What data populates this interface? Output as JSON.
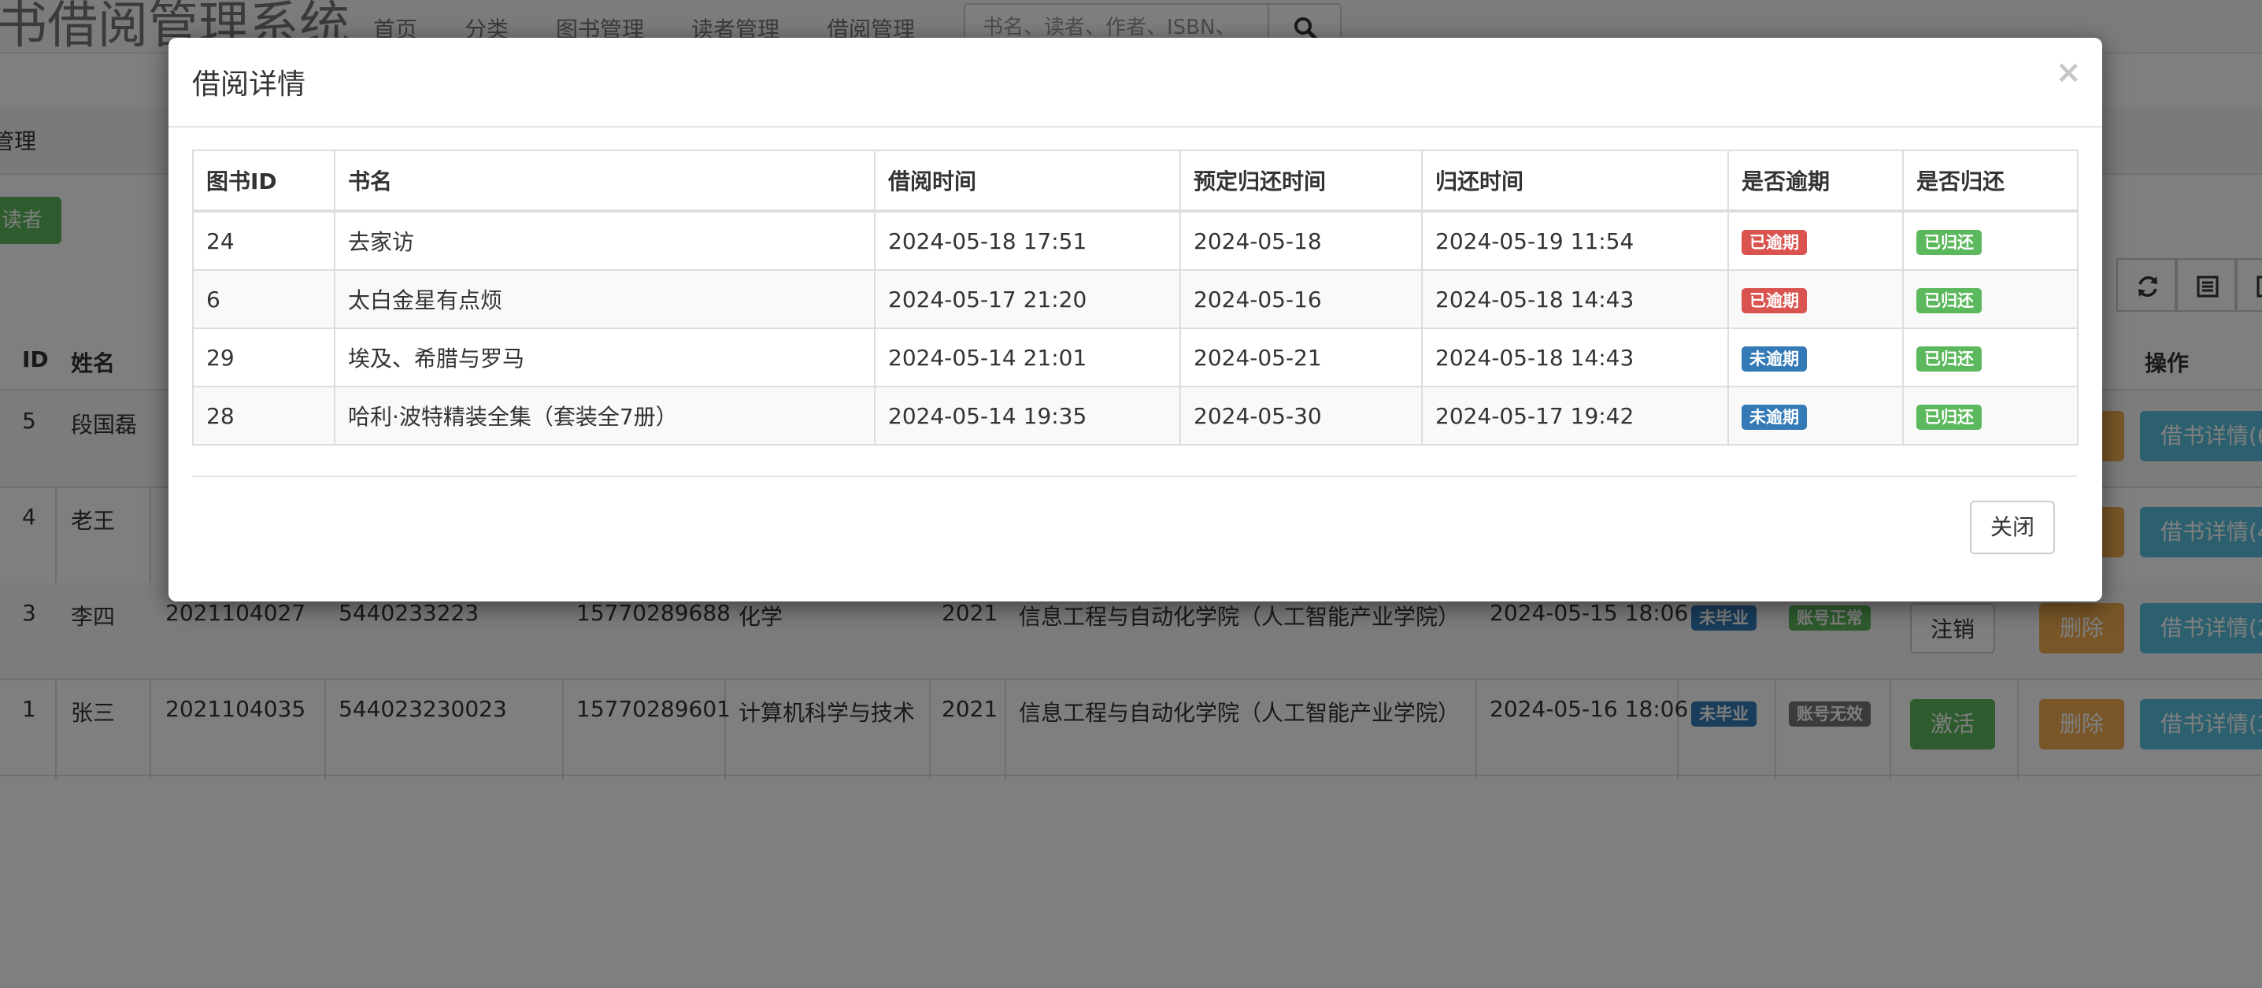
{
  "app": {
    "brand": "书借阅管理系统",
    "nav": [
      "首页",
      "分类",
      "图书管理",
      "读者管理",
      "借阅管理"
    ],
    "search_placeholder": "书名、读者、作者、ISBN、"
  },
  "breadcrumb": "管理",
  "add_reader_label": "读者",
  "reader_table": {
    "headers": [
      "ID",
      "姓名",
      "操作"
    ],
    "rows": [
      {
        "id": "5",
        "name": "段国磊",
        "detail_label": "借书详情(6"
      },
      {
        "id": "4",
        "name": "老王",
        "detail_label": "借书详情(4"
      },
      {
        "id": "3",
        "name": "李四",
        "student_no": "2021104027",
        "card_no": "5440233223",
        "phone": "15770289688",
        "major": "化学",
        "year": "2021",
        "college": "信息工程与自动化学院（人工智能产业学院）",
        "time": "2024-05-15 18:06",
        "grad_status": "未毕业",
        "account_status": "账号正常",
        "action_label": "注销",
        "delete_label": "删除",
        "detail_label": "借书详情(2"
      },
      {
        "id": "1",
        "name": "张三",
        "student_no": "2021104035",
        "card_no": "544023230023",
        "phone": "15770289601",
        "major": "计算机科学与技术",
        "year": "2021",
        "college": "信息工程与自动化学院（人工智能产业学院）",
        "time": "2024-05-16 18:06",
        "grad_status": "未毕业",
        "account_status": "账号无效",
        "action_label": "激活",
        "delete_label": "删除",
        "detail_label": "借书详情(3"
      }
    ]
  },
  "modal": {
    "title": "借阅详情",
    "close_symbol": "×",
    "headers": [
      "图书ID",
      "书名",
      "借阅时间",
      "预定归还时间",
      "归还时间",
      "是否逾期",
      "是否归还"
    ],
    "rows": [
      {
        "book_id": "24",
        "title": "去家访",
        "borrow_time": "2024-05-18 17:51",
        "due_date": "2024-05-18",
        "return_time": "2024-05-19 11:54",
        "overdue": "已逾期",
        "returned": "已归还"
      },
      {
        "book_id": "6",
        "title": "太白金星有点烦",
        "borrow_time": "2024-05-17 21:20",
        "due_date": "2024-05-16",
        "return_time": "2024-05-18 14:43",
        "overdue": "已逾期",
        "returned": "已归还"
      },
      {
        "book_id": "29",
        "title": "埃及、希腊与罗马",
        "borrow_time": "2024-05-14 21:01",
        "due_date": "2024-05-21",
        "return_time": "2024-05-18 14:43",
        "overdue": "未逾期",
        "returned": "已归还"
      },
      {
        "book_id": "28",
        "title": "哈利·波特精装全集（套装全7册）",
        "borrow_time": "2024-05-14 19:35",
        "due_date": "2024-05-30",
        "return_time": "2024-05-17 19:42",
        "overdue": "未逾期",
        "returned": "已归还"
      }
    ],
    "close_button": "关闭"
  },
  "colors": {
    "danger": "#d9534f",
    "success": "#5cb85c",
    "primary": "#337ab7",
    "warning": "#f0ad4e",
    "info": "#5bc0de",
    "default": "#777777"
  }
}
